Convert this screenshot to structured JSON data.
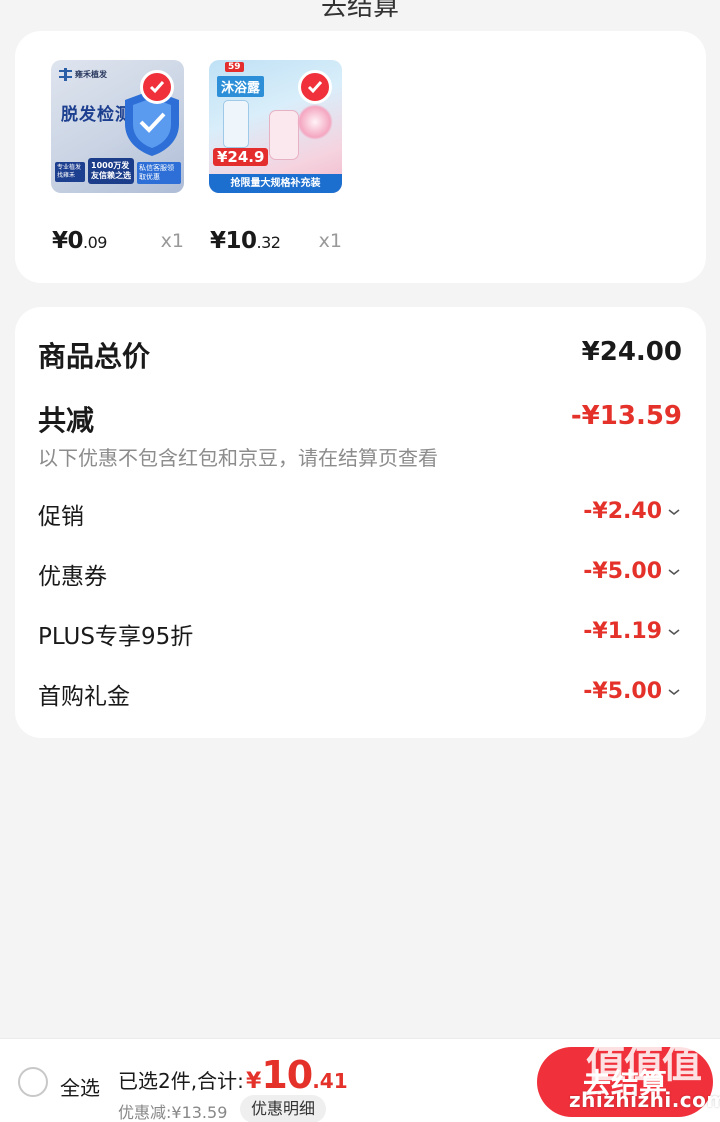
{
  "header": {
    "title": "去结算"
  },
  "products": [
    {
      "image_title": "脱发检测",
      "image_brand": "雍禾植发",
      "image_tags": [
        "专业植发找雍禾",
        "1000万发友信赖之选",
        "私信客服领取优惠"
      ],
      "price_int": "¥0",
      "price_dec": ".09",
      "qty": "x1",
      "selected": true
    },
    {
      "image_title": "沐浴露",
      "image_badge": "59",
      "image_price": "¥24.9",
      "image_banner": "抢限量大规格补充装",
      "price_int": "¥10",
      "price_dec": ".32",
      "qty": "x1",
      "selected": true
    }
  ],
  "summary": {
    "total_label": "商品总价",
    "total_value": "¥24.00",
    "reduce_label": "共减",
    "reduce_value": "-¥13.59",
    "note": "以下优惠不包含红包和京豆，请在结算页查看",
    "discounts": [
      {
        "label": "促销",
        "value": "-¥2.40"
      },
      {
        "label": "优惠券",
        "value": "-¥5.00"
      },
      {
        "label": "PLUS专享95折",
        "value": "-¥1.19"
      },
      {
        "label": "首购礼金",
        "value": "-¥5.00"
      }
    ]
  },
  "bottom": {
    "select_all": "全选",
    "selected_text": "已选2件,合计:",
    "sum_currency": "¥",
    "sum_int": "10",
    "sum_dec": ".41",
    "saved_text": "优惠减:¥13.59",
    "detail_button": "优惠明细",
    "checkout_button": "去结算"
  },
  "watermark": {
    "text": "zhizhizhi.com",
    "glyphs": "值值值"
  },
  "colors": {
    "accent": "#f0303a",
    "discount": "#e4322b",
    "background": "#f4f4f4"
  }
}
